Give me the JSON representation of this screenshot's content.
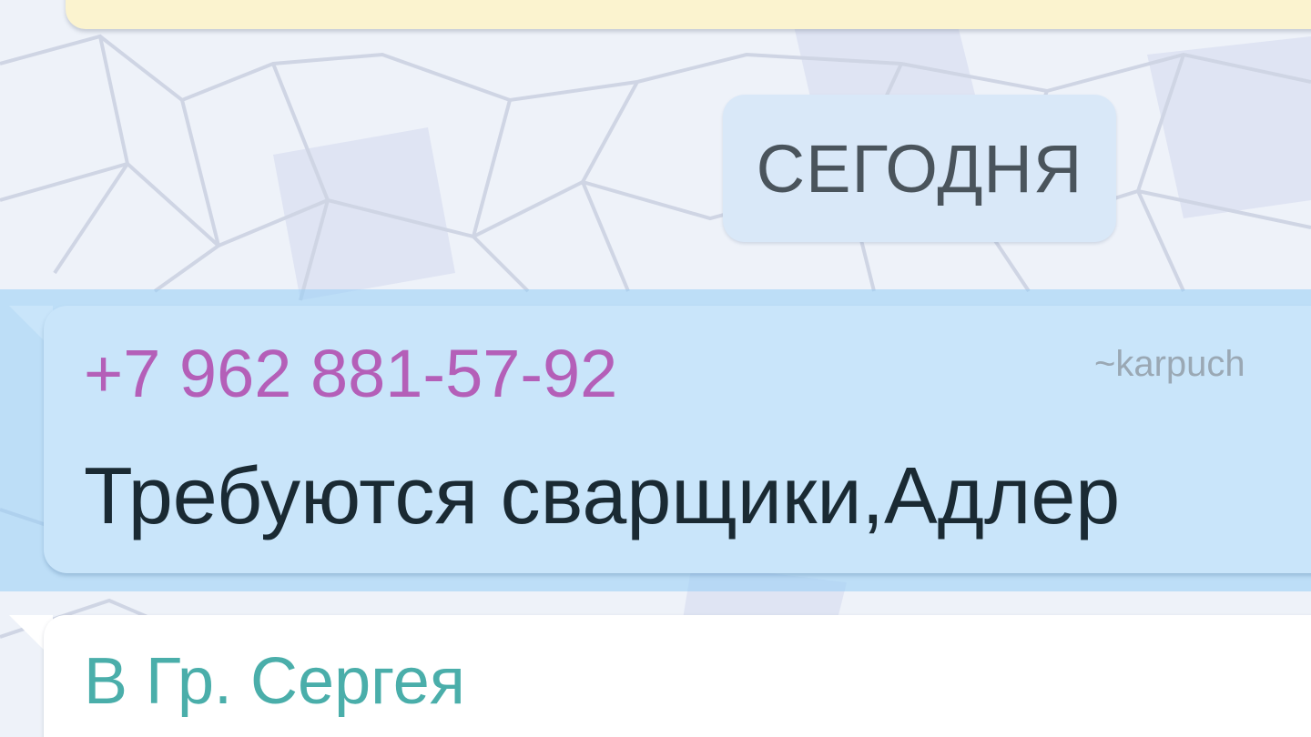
{
  "chat": {
    "date_divider": "СЕГОДНЯ",
    "messages": [
      {
        "sender": "+7 962 881-57-92",
        "handle": "~karpuch",
        "text": "Требуются сварщики,Адлер",
        "sender_color": "#b45fb8"
      },
      {
        "sender": "В Гр. Сергея",
        "sender_color": "#4aaeaa"
      }
    ]
  },
  "colors": {
    "incoming_selected_bubble": "#c9e5fa",
    "selection_highlight": "#96cdf5",
    "date_chip": "#d9e8f8",
    "previous_bubble": "#fbf3cf"
  }
}
